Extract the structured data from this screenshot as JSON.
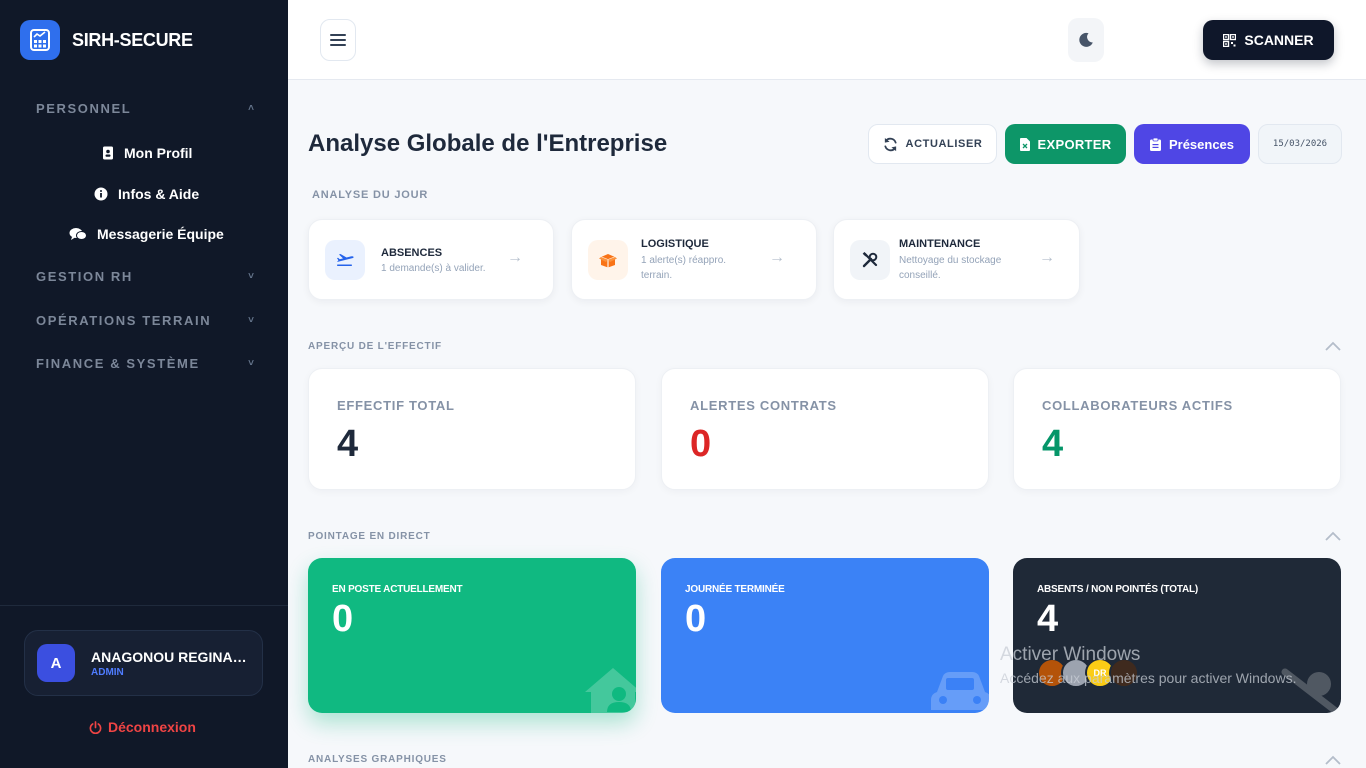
{
  "brand": {
    "name": "SIRH-SECURE"
  },
  "sidebar": {
    "sections": [
      {
        "label": "PERSONNEL",
        "chevron": "˄"
      },
      {
        "label": "GESTION RH",
        "chevron": "˅"
      },
      {
        "label": "OPÉRATIONS TERRAIN",
        "chevron": "˅"
      },
      {
        "label": "FINANCE & SYSTÈME",
        "chevron": "˅"
      }
    ],
    "items": [
      {
        "label": "Mon Profil",
        "icon": "id-badge-icon"
      },
      {
        "label": "Infos & Aide",
        "icon": "info-circle-icon"
      },
      {
        "label": "Messagerie Équipe",
        "icon": "chat-bubbles-icon"
      }
    ],
    "user": {
      "initial": "A",
      "name": "ANAGONOU REGINALD",
      "role": "ADMIN"
    },
    "logout_label": "Déconnexion"
  },
  "header": {
    "scanner_label": "SCANNER"
  },
  "main": {
    "title": "Analyse Globale de l'Entreprise",
    "actions": {
      "refresh_label": "ACTUALISER",
      "export_label": "EXPORTER",
      "presence_label": "Présences",
      "date": "15/03/2026"
    },
    "daily": {
      "section_label": "ANALYSE DU JOUR",
      "cards": [
        {
          "title": "ABSENCES",
          "desc": "1 demande(s) à valider.",
          "icon": "plane-icon",
          "color": "#2563eb"
        },
        {
          "title": "LOGISTIQUE",
          "desc_line1": "1 alerte(s) réappro.",
          "desc_line2": "terrain.",
          "icon": "box-icon",
          "color": "#f97316"
        },
        {
          "title": "MAINTENANCE",
          "desc_line1": "Nettoyage du stockage",
          "desc_line2": "conseillé.",
          "icon": "tools-icon",
          "color": "#1e293b"
        }
      ]
    },
    "overview": {
      "section_label": "APERÇU DE L'EFFECTIF",
      "cards": [
        {
          "label": "EFFECTIF TOTAL",
          "value": "4",
          "color": "#1e293b"
        },
        {
          "label": "ALERTES CONTRATS",
          "value": "0",
          "color": "#dc2626"
        },
        {
          "label": "COLLABORATEURS ACTIFS",
          "value": "4",
          "color": "#059669"
        }
      ]
    },
    "live": {
      "section_label": "POINTAGE EN DIRECT",
      "cards": [
        {
          "label": "EN POSTE ACTUELLEMENT",
          "value": "0",
          "color": "#10b981"
        },
        {
          "label": "JOURNÉE TERMINÉE",
          "value": "0",
          "color": "#3b82f6"
        },
        {
          "label": "ABSENTS / NON POINTÉS (TOTAL)",
          "value": "4",
          "color": "#1f2937"
        }
      ],
      "avatar_initials": "DR"
    },
    "charts": {
      "section_label": "ANALYSES GRAPHIQUES"
    }
  },
  "watermark": {
    "title": "Activer Windows",
    "subtitle": "Accédez aux paramètres pour activer Windows."
  }
}
